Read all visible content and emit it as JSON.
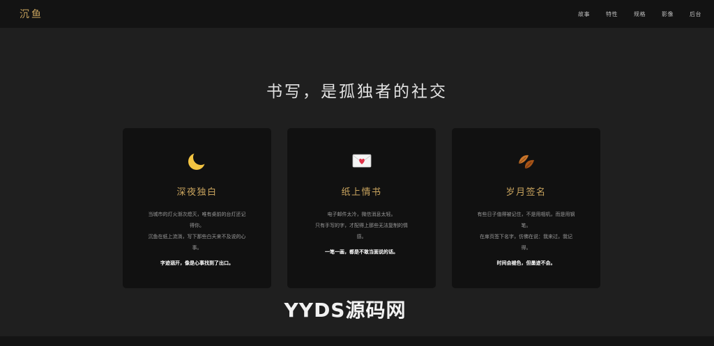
{
  "brand": {
    "logo": "沉鱼"
  },
  "nav": {
    "items": [
      "故事",
      "特性",
      "规格",
      "影像",
      "后台"
    ]
  },
  "hero": {
    "heading": "书写，是孤独者的社交"
  },
  "cards": [
    {
      "icon": "crescent-moon-icon",
      "title": "深夜独白",
      "lines": [
        "当城市的灯火渐次熄灭，唯有桌前的台灯还记",
        "得你。",
        "沉鱼在纸上流淌，写下那些白天来不及说的心",
        "事。"
      ],
      "tagline": "字迹洇开，像是心事找到了出口。"
    },
    {
      "icon": "love-letter-icon",
      "title": "纸上情书",
      "lines": [
        "电子邮件太冷，微信消息太轻。",
        "只有手写的字，才配得上那些无法复制的情",
        "感。"
      ],
      "tagline": "一笔一画，都是不敢当面说的话。"
    },
    {
      "icon": "fallen-leaves-icon",
      "title": "岁月签名",
      "lines": [
        "有些日子值得被记住，不是用相机，而是用钢",
        "笔。",
        "在扉页签下名字，仿佛在说：我来过，我记",
        "得。"
      ],
      "tagline": "时间会褪色，但墨迹不会。"
    }
  ],
  "watermark": {
    "text": "YYDS源码网"
  }
}
